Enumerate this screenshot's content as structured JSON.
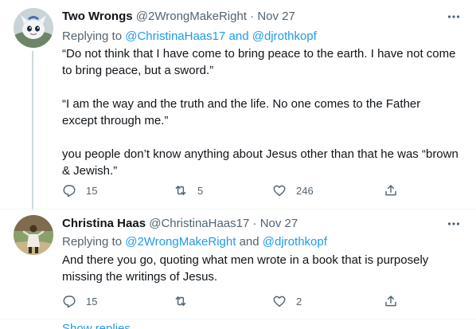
{
  "tweets": [
    {
      "name": "Two Wrongs",
      "handle": "@2WrongMakeRight",
      "separator": "·",
      "date": "Nov 27",
      "reply_prefix": "Replying to ",
      "reply_user_1": "@ChristinaHaas17",
      "reply_and": " and ",
      "reply_user_2": "@djrothkopf",
      "paragraphs": [
        "“Do not think that I have come to bring peace to the earth. I have not come to bring peace, but a sword.”",
        "“I am the way and the truth and the life. No one comes to the Father except through me.”",
        "you people don’t know anything about Jesus other than that he was “brown & Jewish.”"
      ],
      "replies": "15",
      "retweets": "5",
      "likes": "246",
      "more_icon": "ellipsis-icon"
    },
    {
      "name": "Christina Haas",
      "handle": "@ChristinaHaas17",
      "separator": "·",
      "date": "Nov 27",
      "reply_prefix": "Replying to ",
      "reply_user_1": "@2WrongMakeRight",
      "reply_and": " and ",
      "reply_user_2": "@djrothkopf",
      "paragraphs": [
        "And there you go, quoting what men wrote in a book that is purposely missing the writings of Jesus."
      ],
      "replies": "15",
      "retweets": "",
      "likes": "2",
      "more_icon": "ellipsis-icon"
    }
  ],
  "show_more": "Show replies",
  "colors": {
    "text": "#0f1419",
    "secondary": "#536471",
    "link": "#1d9bf0",
    "border": "#eff3f4",
    "thread_line": "#cfd9de"
  }
}
